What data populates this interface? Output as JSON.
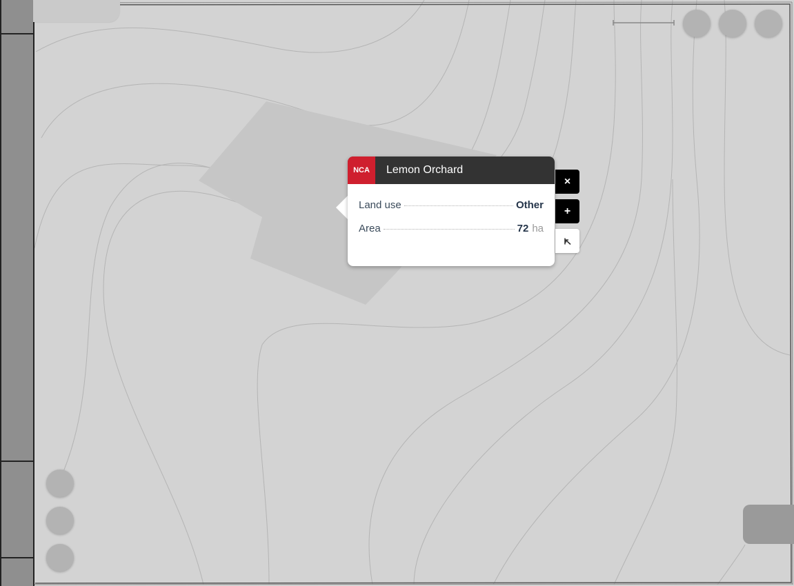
{
  "popup": {
    "badge": "NCA",
    "title": "Lemon Orchard",
    "rows": [
      {
        "label": "Land use",
        "value": "Other",
        "unit": ""
      },
      {
        "label": "Area",
        "value": "72",
        "unit": "ha"
      }
    ]
  },
  "actions": {
    "close_icon": "×",
    "add_icon": "+",
    "locate_icon": "↸"
  },
  "icons": {
    "close": "close-icon",
    "add": "plus-icon",
    "locate": "arrow-to-corner-icon"
  },
  "colors": {
    "map_background": "#d3d3d3",
    "parcel": "#c6c6c6",
    "badge": "#cf1f2e",
    "header": "#333333",
    "sidebar": "#8f8f8f"
  }
}
